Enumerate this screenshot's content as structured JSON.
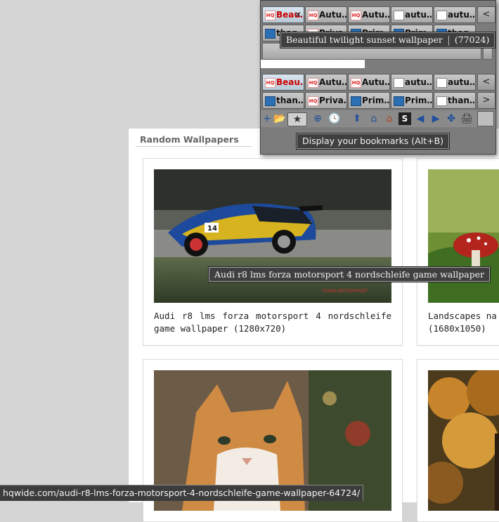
{
  "page": {
    "section_title": "Random Wallpapers",
    "cards": [
      {
        "caption": "Audi r8 lms forza motorsport 4 nordschleife game wallpaper (1280x720)",
        "image": "audi-r8-race-car-image"
      },
      {
        "caption": "Landscapes na\n(1680x1050)",
        "image": "mushroom-image"
      },
      {
        "caption": "",
        "image": "orange-cat-image"
      },
      {
        "caption": "",
        "image": "autumn-tree-image"
      }
    ],
    "image_tooltip": "Audi r8 lms forza motorsport 4 nordschleife game wallpaper"
  },
  "status_bar": {
    "url": "hqwide.com/audi-r8-lms-forza-motorsport-4-nordschleife-game-wallpaper-64724/"
  },
  "toolbar": {
    "tab_rows": [
      [
        "Beau…",
        "Autu…",
        "Autu…",
        "autu…",
        "autu…"
      ],
      [
        "than…",
        "Priva…",
        "Prim…",
        "Prim…",
        "than…"
      ],
      [
        "Beau…",
        "Autu…",
        "Autu…",
        "autu…",
        "autu…"
      ],
      [
        "than…",
        "Priva…",
        "Prim…",
        "Prim…",
        "than…"
      ]
    ],
    "tab_close_glyph": "✕",
    "title_tooltip": "Beautiful twilight sunset wallpaper",
    "title_count": "(77024)",
    "nav_left": "<",
    "nav_right": ">",
    "bookmarks_tooltip": "Display your bookmarks (Alt+B)",
    "tools": [
      "plus-icon",
      "folder-icon",
      "bookmark-star-icon",
      "add-group-icon",
      "history-icon",
      "save-icon",
      "home-icon",
      "home-alt-icon",
      "s-icon",
      "back-arrow-icon",
      "forward-arrow-icon",
      "puzzle-icon",
      "printer-icon",
      "panel-toggle-icon"
    ],
    "tool_glyphs": [
      "+",
      "📂",
      "★",
      "⊕",
      "🕓",
      "⬆",
      "⌂",
      "⌂",
      "S",
      "◀",
      "▶",
      "✤",
      "🖨",
      ""
    ]
  },
  "colors": {
    "accent_red": "#cc0000",
    "panel_bg": "#7c7c7c"
  }
}
